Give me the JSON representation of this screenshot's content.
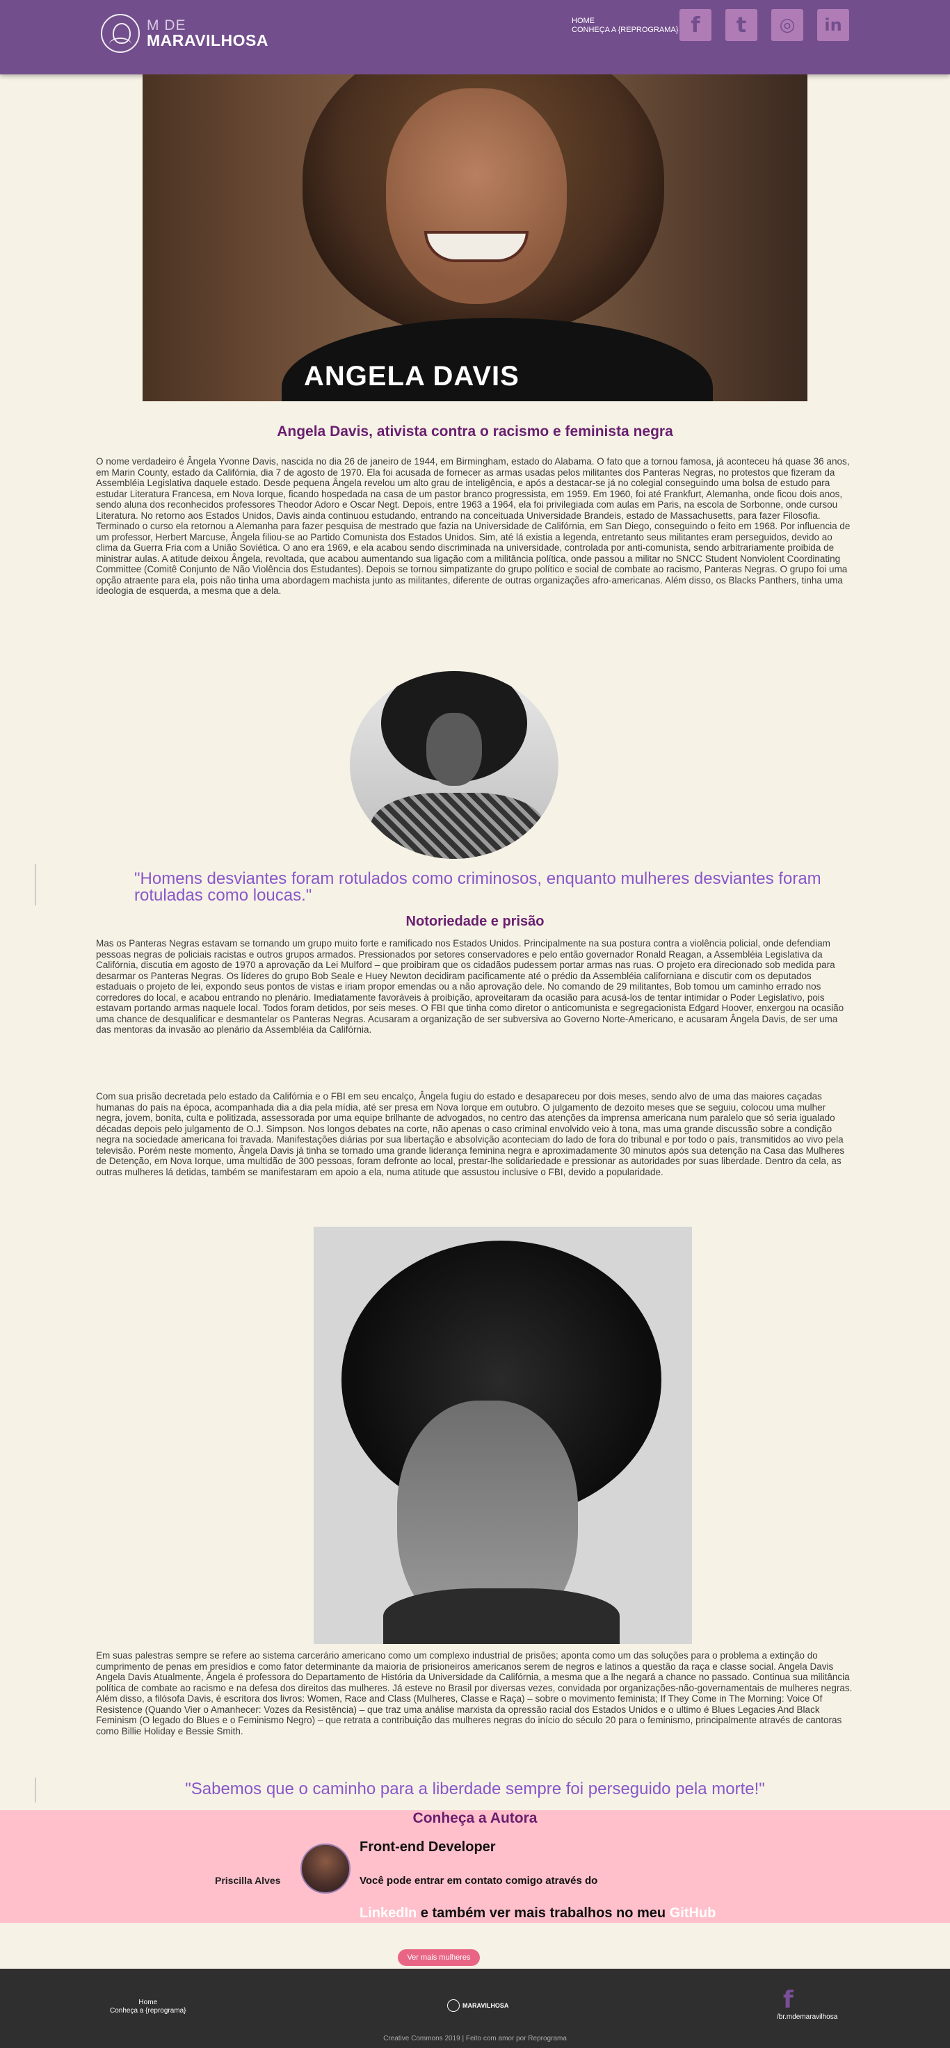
{
  "header": {
    "logo_small": "M DE",
    "logo_big": "MARAVILHOSA",
    "nav": [
      "HOME",
      "CONHEÇA A {REPROGRAMA}"
    ],
    "social_icons": [
      "facebook-icon",
      "twitter-icon",
      "instagram-icon",
      "linkedin-icon"
    ]
  },
  "hero": {
    "title": "ANGELA DAVIS"
  },
  "article": {
    "heading": "Angela Davis, ativista contra o racismo e feminista negra",
    "p1": "O nome verdadeiro é Ângela Yvonne Davis, nascida no dia 26 de janeiro de 1944, em Birmingham, estado do Alabama. O fato que a tornou famosa, já aconteceu há quase 36 anos, em Marin County, estado da Califórnia, dia 7 de agosto de 1970. Ela foi acusada de fornecer as armas usadas pelos militantes dos Panteras Negras, no protestos que fizeram da Assembléia Legislativa daquele estado. Desde pequena Ângela revelou um alto grau de inteligência, e após a destacar-se já no colegial conseguindo uma bolsa de estudo para estudar Literatura Francesa, em Nova Iorque, ficando hospedada na casa de um pastor branco progressista, em 1959. Em 1960, foi até Frankfurt, Alemanha, onde ficou dois anos, sendo aluna dos reconhecidos professores Theodor Adoro e Oscar Negt. Depois, entre 1963 a 1964, ela foi privilegiada com aulas em Paris, na escola de Sorbonne, onde cursou Literatura. No retorno aos Estados Unidos, Davis ainda continuou estudando, entrando na conceituada Universidade Brandeis, estado de Massachusetts, para fazer Filosofia. Terminado o curso ela retornou a Alemanha para fazer pesquisa de mestrado que fazia na Universidade de Califórnia, em San Diego, conseguindo o feito em 1968. Por influencia de um professor, Herbert Marcuse, Ângela filiou-se ao Partido Comunista dos Estados Unidos. Sim, até lá existia a legenda, entretanto seus militantes eram perseguidos, devido ao clima da Guerra Fria com a União Soviética. O ano era 1969, e ela acabou sendo discriminada na universidade, controlada por anti-comunista, sendo arbitrariamente proibida de ministrar aulas. A atitude deixou Ângela, revoltada, que acabou aumentando sua ligação com a militância política, onde passou a militar no SNCC Student Nonviolent Coordinating Committee (Comitê Conjunto de Não Violência dos Estudantes). Depois se tornou simpatizante do grupo político e social de combate ao racismo, Panteras Negras. O grupo foi uma opção atraente para ela, pois não tinha uma abordagem machista junto as militantes, diferente de outras organizações afro-americanas. Além disso, os Blacks Panthers, tinha uma ideologia de esquerda, a mesma que a dela.",
    "quote1": "\"Homens desviantes foram rotulados como criminosos, enquanto mulheres desviantes foram rotuladas como loucas.\"",
    "heading2": "Notoriedade e prisão",
    "p2": "Mas os Panteras Negras estavam se tornando um grupo muito forte e ramificado nos Estados Unidos. Principalmente na sua postura contra a violência policial, onde defendiam pessoas negras de policiais racistas e outros grupos armados. Pressionados por setores conservadores e pelo então governador Ronald Reagan, a Assembléia Legislativa da Califórnia, discutia em agosto de 1970 a aprovação da Lei Mulford – que proibiram que os cidadãos pudessem portar armas nas ruas. O projeto era direcionado sob medida para desarmar os Panteras Negras. Os líderes do grupo Bob Seale e Huey Newton decidiram pacificamente até o prédio da Assembléia californiana e discutir com os deputados estaduais o projeto de lei, expondo seus pontos de vistas e iriam propor emendas ou a não aprovação dele. No comando de 29 militantes, Bob tomou um caminho errado nos corredores do local, e acabou entrando no plenário. Imediatamente favoráveis à proibição, aproveitaram da ocasião para acusá-los de tentar intimidar o Poder Legislativo, pois estavam portando armas naquele local. Todos foram detidos, por seis meses. O FBI que tinha como diretor o anticomunista e segregacionista Edgard Hoover, enxergou na ocasião uma chance de desqualificar e desmantelar os Panteras Negras. Acusaram a organização de ser subversiva ao Governo Norte-Americano, e acusaram Ângela Davis, de ser uma das mentoras da invasão ao plenário da Assembléia da Califórnia.",
    "p3": "Com sua prisão decretada pelo estado da Califórnia e o FBI em seu encalço, Ângela fugiu do estado e desapareceu por dois meses, sendo alvo de uma das maiores caçadas humanas do país na época, acompanhada dia a dia pela mídia, até ser presa em Nova Iorque em outubro. O julgamento de dezoito meses que se seguiu, colocou uma mulher negra, jovem, bonita, culta e politizada, assessorada por uma equipe brilhante de advogados, no centro das atenções da imprensa americana num paralelo que só seria igualado décadas depois pelo julgamento de O.J. Simpson. Nos longos debates na corte, não apenas o caso criminal envolvido veio à tona, mas uma grande discussão sobre a condição negra na sociedade americana foi travada. Manifestações diárias por sua libertação e absolvição aconteciam do lado de fora do tribunal e por todo o país, transmitidos ao vivo pela televisão. Porém neste momento, Ângela Davis já tinha se tornado uma grande liderança feminina negra e aproximadamente 30 minutos após sua detenção na Casa das Mulheres de Detenção, em Nova Iorque, uma multidão de 300 pessoas, foram defronte ao local, prestar-lhe solidariedade e pressionar as autoridades por suas liberdade. Dentro da cela, as outras mulheres lá detidas, também se manifestaram em apoio a ela, numa atitude que assustou inclusive o FBI, devido a popularidade.",
    "p4": "Em suas palestras sempre se refere ao sistema carcerário americano como um complexo industrial de prisões; aponta como um das soluções para o problema a extinção do cumprimento de penas em presídios e como fator determinante da maioria de prisioneiros americanos serem de negros e latinos a questão da raça e classe social. Angela Davis Angela Davis Atualmente, Ângela é professora do Departamento de História da Universidade da Califórnia, a mesma que a lhe negará a chance no passado. Continua sua militância política de combate ao racismo e na defesa dos direitos das mulheres. Já esteve no Brasil por diversas vezes, convidada por organizações-não-governamentais de mulheres negras. Além disso, a filósofa Davis, é escritora dos livros: Women, Race and Class (Mulheres, Classe e Raça) – sobre o movimento feminista; If They Come in The Morning: Voice Of Resistence (Quando Vier o Amanhecer: Vozes da Resistência) – que traz uma análise marxista da opressão racial dos Estados Unidos e o ultimo é Blues Legacies And Black Feminism (O legado do Blues e o Feminismo Negro) – que retrata a contribuição das mulheres negras do início do século 20 para o feminismo, principalmente através de cantoras como Billie Holiday e Bessie Smith.",
    "quote2": "\"Sabemos que o caminho para a liberdade sempre foi perseguido pela morte!\""
  },
  "author": {
    "heading": "Conheça a Autora",
    "name": "Priscilla Alves",
    "role": "Front-end Developer",
    "contact": "Você pode entrar em contato comigo através do",
    "linkedin": "LinkedIn",
    "middle": " e também ver mais trabalhos no meu ",
    "github": "GitHub"
  },
  "more_button": "Ver mais mulheres",
  "footer": {
    "links": [
      "Home",
      "Conheça a {reprograma}"
    ],
    "logo": "MARAVILHOSA",
    "fb_handle": "/br.mdemaravilhosa",
    "copyright": "Creative Commons 2019 | Feito com amor por Reprograma"
  }
}
